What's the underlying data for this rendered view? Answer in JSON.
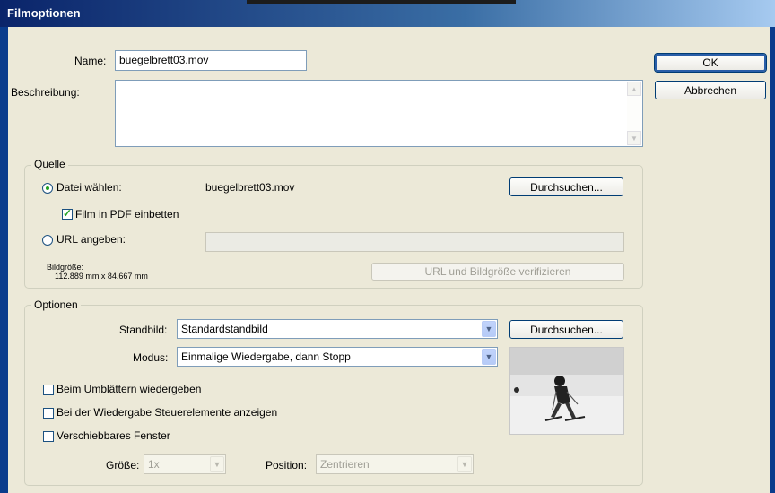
{
  "dialog": {
    "title": "Filmoptionen"
  },
  "name_field": {
    "label": "Name:",
    "value": "buegelbrett03.mov"
  },
  "description_field": {
    "label": "Beschreibung:",
    "value": ""
  },
  "buttons": {
    "ok": "OK",
    "cancel": "Abbrechen"
  },
  "source_group": {
    "title": "Quelle",
    "choose_file_label": "Datei wählen:",
    "chosen_file": "buegelbrett03.mov",
    "browse_label": "Durchsuchen...",
    "embed_label": "Film in PDF einbetten",
    "embed_checked": true,
    "url_label": "URL angeben:",
    "url_value": "",
    "image_size_label": "Bildgröße:",
    "image_size_value": "112.889 mm x 84.667 mm",
    "verify_label": "URL und Bildgröße verifizieren"
  },
  "options_group": {
    "title": "Optionen",
    "poster_label": "Standbild:",
    "poster_value": "Standardstandbild",
    "poster_browse_label": "Durchsuchen...",
    "mode_label": "Modus:",
    "mode_value": "Einmalige Wiedergabe, dann Stopp",
    "play_on_turn_label": "Beim Umblättern wiedergeben",
    "show_controls_label": "Bei der Wiedergabe Steuerelemente anzeigen",
    "floating_window_label": "Verschiebbares Fenster",
    "size_label": "Größe:",
    "size_value": "1x",
    "position_label": "Position:",
    "position_value": "Zentrieren"
  },
  "colors": {
    "accent": "#0a246a",
    "dialog_bg": "#ece9d8",
    "check_green": "#21a121"
  },
  "icons": {
    "combo_arrow": "chevron-down-icon",
    "scroll_up": "scroll-up-icon",
    "scroll_down": "scroll-down-icon"
  }
}
